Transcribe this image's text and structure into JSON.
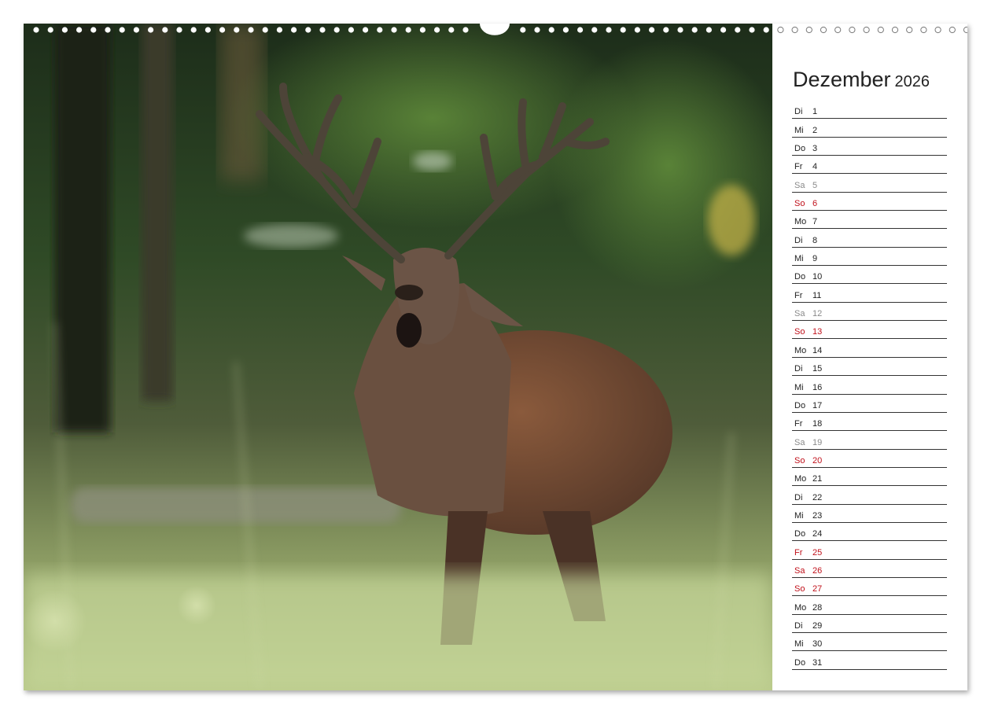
{
  "calendar": {
    "month": "Dezember",
    "year": "2026",
    "days": [
      {
        "wd": "Di",
        "d": "1",
        "t": "n"
      },
      {
        "wd": "Mi",
        "d": "2",
        "t": "n"
      },
      {
        "wd": "Do",
        "d": "3",
        "t": "n"
      },
      {
        "wd": "Fr",
        "d": "4",
        "t": "n"
      },
      {
        "wd": "Sa",
        "d": "5",
        "t": "sat"
      },
      {
        "wd": "So",
        "d": "6",
        "t": "hol"
      },
      {
        "wd": "Mo",
        "d": "7",
        "t": "n"
      },
      {
        "wd": "Di",
        "d": "8",
        "t": "n"
      },
      {
        "wd": "Mi",
        "d": "9",
        "t": "n"
      },
      {
        "wd": "Do",
        "d": "10",
        "t": "n"
      },
      {
        "wd": "Fr",
        "d": "11",
        "t": "n"
      },
      {
        "wd": "Sa",
        "d": "12",
        "t": "sat"
      },
      {
        "wd": "So",
        "d": "13",
        "t": "hol"
      },
      {
        "wd": "Mo",
        "d": "14",
        "t": "n"
      },
      {
        "wd": "Di",
        "d": "15",
        "t": "n"
      },
      {
        "wd": "Mi",
        "d": "16",
        "t": "n"
      },
      {
        "wd": "Do",
        "d": "17",
        "t": "n"
      },
      {
        "wd": "Fr",
        "d": "18",
        "t": "n"
      },
      {
        "wd": "Sa",
        "d": "19",
        "t": "sat"
      },
      {
        "wd": "So",
        "d": "20",
        "t": "hol"
      },
      {
        "wd": "Mo",
        "d": "21",
        "t": "n"
      },
      {
        "wd": "Di",
        "d": "22",
        "t": "n"
      },
      {
        "wd": "Mi",
        "d": "23",
        "t": "n"
      },
      {
        "wd": "Do",
        "d": "24",
        "t": "n"
      },
      {
        "wd": "Fr",
        "d": "25",
        "t": "hol"
      },
      {
        "wd": "Sa",
        "d": "26",
        "t": "hol"
      },
      {
        "wd": "So",
        "d": "27",
        "t": "hol"
      },
      {
        "wd": "Mo",
        "d": "28",
        "t": "n"
      },
      {
        "wd": "Di",
        "d": "29",
        "t": "n"
      },
      {
        "wd": "Mi",
        "d": "30",
        "t": "n"
      },
      {
        "wd": "Do",
        "d": "31",
        "t": "n"
      }
    ]
  },
  "colors": {
    "holiday": "#c0101a",
    "saturday": "#8a8a8a",
    "text": "#222222"
  },
  "photo": {
    "subject": "red-deer-stag-icon"
  }
}
